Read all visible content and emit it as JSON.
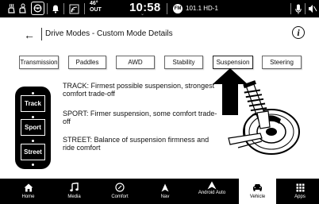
{
  "status_bar": {
    "temperature": "46°",
    "temperature_unit": "OUT",
    "time": "10:58",
    "radio_badge": "FM",
    "radio_station": "101.1 HD-1",
    "icons": [
      "seat-heat-icon",
      "seat-cool-icon",
      "heated-wheel-icon",
      "notification-bell-icon",
      "wireless-icon",
      "microphone-icon",
      "mute-icon"
    ]
  },
  "header": {
    "back_symbol": "←",
    "title": "Drive Modes - Custom Mode Details",
    "info_symbol": "i"
  },
  "tabs": [
    {
      "label": "Transmission",
      "active": false
    },
    {
      "label": "Paddles",
      "active": false
    },
    {
      "label": "AWD",
      "active": false
    },
    {
      "label": "Stability",
      "active": false
    },
    {
      "label": "Suspension",
      "active": true
    },
    {
      "label": "Steering",
      "active": false
    }
  ],
  "modes": [
    {
      "label": "Track",
      "description": "TRACK: Firmest possible suspension, strongest comfort trade-off"
    },
    {
      "label": "Sport",
      "description": "SPORT: Firmer suspension, some comfort trade-off"
    },
    {
      "label": "Street",
      "description": "STREET: Balance of suspension firmness and ride comfort"
    }
  ],
  "nav": [
    {
      "label": "Home",
      "icon": "home-icon",
      "active": false
    },
    {
      "label": "Media",
      "icon": "music-note-icon",
      "active": false
    },
    {
      "label": "Comfort",
      "icon": "comfort-icon",
      "active": false
    },
    {
      "label": "Nav",
      "icon": "navigation-arrow-icon",
      "active": false
    },
    {
      "label": "Android Auto",
      "icon": "android-auto-icon",
      "active": false
    },
    {
      "label": "Vehicle",
      "icon": "vehicle-icon",
      "active": true
    },
    {
      "label": "Apps",
      "icon": "apps-grid-icon",
      "active": false
    }
  ],
  "colors": {
    "bars": "#000000",
    "background": "#ffffff",
    "active_nav": "#ffffff"
  }
}
